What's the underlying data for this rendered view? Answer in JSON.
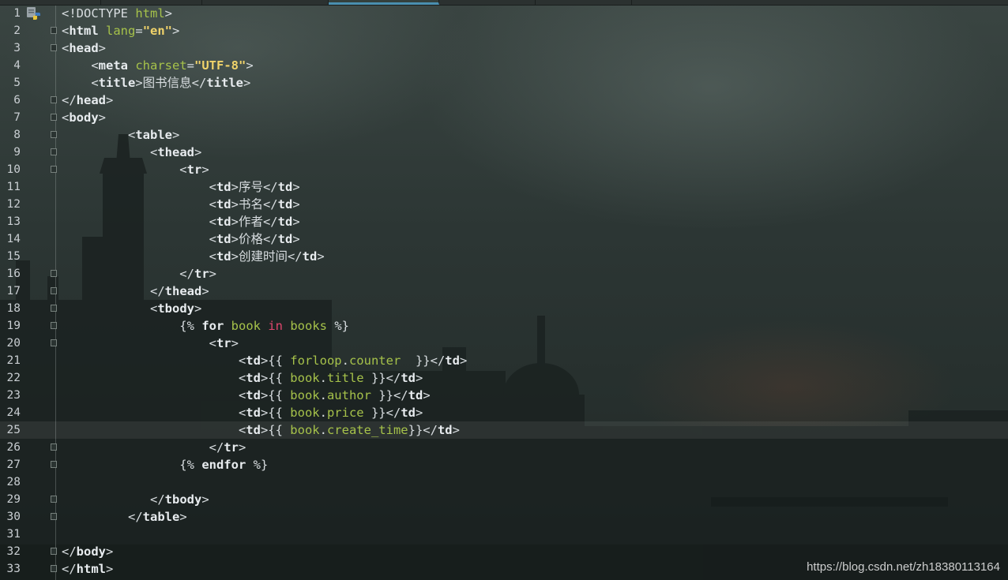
{
  "watermark": "https://blog.csdn.net/zh18380113164",
  "lines": [
    {
      "n": "1",
      "segs": [
        [
          "p",
          "<!DOCTYPE "
        ],
        [
          "attr",
          "html"
        ],
        [
          "p",
          ">"
        ]
      ]
    },
    {
      "n": "2",
      "segs": [
        [
          "p",
          "<"
        ],
        [
          "tag",
          "html"
        ],
        [
          "p",
          " "
        ],
        [
          "attr",
          "lang"
        ],
        [
          "p",
          "="
        ],
        [
          "str",
          "\"en\""
        ],
        [
          "p",
          ">"
        ]
      ]
    },
    {
      "n": "3",
      "segs": [
        [
          "p",
          "<"
        ],
        [
          "tag",
          "head"
        ],
        [
          "p",
          ">"
        ]
      ]
    },
    {
      "n": "4",
      "segs": [
        [
          "p",
          "    <"
        ],
        [
          "tag",
          "meta"
        ],
        [
          "p",
          " "
        ],
        [
          "attr",
          "charset"
        ],
        [
          "p",
          "="
        ],
        [
          "str",
          "\"UTF-8\""
        ],
        [
          "p",
          ">"
        ]
      ]
    },
    {
      "n": "5",
      "segs": [
        [
          "p",
          "    <"
        ],
        [
          "tag",
          "title"
        ],
        [
          "p",
          ">图书信息</"
        ],
        [
          "tag",
          "title"
        ],
        [
          "p",
          ">"
        ]
      ]
    },
    {
      "n": "6",
      "segs": [
        [
          "p",
          "</"
        ],
        [
          "tag",
          "head"
        ],
        [
          "p",
          ">"
        ]
      ]
    },
    {
      "n": "7",
      "segs": [
        [
          "p",
          "<"
        ],
        [
          "tag",
          "body"
        ],
        [
          "p",
          ">"
        ]
      ]
    },
    {
      "n": "8",
      "segs": [
        [
          "p",
          "         <"
        ],
        [
          "tag",
          "table"
        ],
        [
          "p",
          ">"
        ]
      ]
    },
    {
      "n": "9",
      "segs": [
        [
          "p",
          "            <"
        ],
        [
          "tag",
          "thead"
        ],
        [
          "p",
          ">"
        ]
      ]
    },
    {
      "n": "10",
      "segs": [
        [
          "p",
          "                <"
        ],
        [
          "tag",
          "tr"
        ],
        [
          "p",
          ">"
        ]
      ]
    },
    {
      "n": "11",
      "segs": [
        [
          "p",
          "                    <"
        ],
        [
          "tag",
          "td"
        ],
        [
          "p",
          ">序号</"
        ],
        [
          "tag",
          "td"
        ],
        [
          "p",
          ">"
        ]
      ]
    },
    {
      "n": "12",
      "segs": [
        [
          "p",
          "                    <"
        ],
        [
          "tag",
          "td"
        ],
        [
          "p",
          ">书名</"
        ],
        [
          "tag",
          "td"
        ],
        [
          "p",
          ">"
        ]
      ]
    },
    {
      "n": "13",
      "segs": [
        [
          "p",
          "                    <"
        ],
        [
          "tag",
          "td"
        ],
        [
          "p",
          ">作者</"
        ],
        [
          "tag",
          "td"
        ],
        [
          "p",
          ">"
        ]
      ]
    },
    {
      "n": "14",
      "segs": [
        [
          "p",
          "                    <"
        ],
        [
          "tag",
          "td"
        ],
        [
          "p",
          ">价格</"
        ],
        [
          "tag",
          "td"
        ],
        [
          "p",
          ">"
        ]
      ]
    },
    {
      "n": "15",
      "segs": [
        [
          "p",
          "                    <"
        ],
        [
          "tag",
          "td"
        ],
        [
          "p",
          ">创建时间</"
        ],
        [
          "tag",
          "td"
        ],
        [
          "p",
          ">"
        ]
      ]
    },
    {
      "n": "16",
      "segs": [
        [
          "p",
          "                </"
        ],
        [
          "tag",
          "tr"
        ],
        [
          "p",
          ">"
        ]
      ]
    },
    {
      "n": "17",
      "segs": [
        [
          "p",
          "            </"
        ],
        [
          "tag",
          "thead"
        ],
        [
          "p",
          ">"
        ]
      ]
    },
    {
      "n": "18",
      "segs": [
        [
          "p",
          "            <"
        ],
        [
          "tag",
          "tbody"
        ],
        [
          "p",
          ">"
        ]
      ]
    },
    {
      "n": "19",
      "segs": [
        [
          "p",
          "                {% "
        ],
        [
          "kw",
          "for"
        ],
        [
          "p",
          " "
        ],
        [
          "var",
          "book"
        ],
        [
          "p",
          " "
        ],
        [
          "kwin",
          "in"
        ],
        [
          "p",
          " "
        ],
        [
          "var",
          "books"
        ],
        [
          "p",
          " %}"
        ]
      ]
    },
    {
      "n": "20",
      "segs": [
        [
          "p",
          "                    <"
        ],
        [
          "tag",
          "tr"
        ],
        [
          "p",
          ">"
        ]
      ]
    },
    {
      "n": "21",
      "segs": [
        [
          "p",
          "                        <"
        ],
        [
          "tag",
          "td"
        ],
        [
          "p",
          ">{{ "
        ],
        [
          "var",
          "forloop"
        ],
        [
          "p",
          "."
        ],
        [
          "var",
          "counter"
        ],
        [
          "p",
          "  }}</"
        ],
        [
          "tag",
          "td"
        ],
        [
          "p",
          ">"
        ]
      ]
    },
    {
      "n": "22",
      "segs": [
        [
          "p",
          "                        <"
        ],
        [
          "tag",
          "td"
        ],
        [
          "p",
          ">{{ "
        ],
        [
          "var",
          "book"
        ],
        [
          "p",
          "."
        ],
        [
          "var",
          "title"
        ],
        [
          "p",
          " }}</"
        ],
        [
          "tag",
          "td"
        ],
        [
          "p",
          ">"
        ]
      ]
    },
    {
      "n": "23",
      "segs": [
        [
          "p",
          "                        <"
        ],
        [
          "tag",
          "td"
        ],
        [
          "p",
          ">{{ "
        ],
        [
          "var",
          "book"
        ],
        [
          "p",
          "."
        ],
        [
          "var",
          "author"
        ],
        [
          "p",
          " }}</"
        ],
        [
          "tag",
          "td"
        ],
        [
          "p",
          ">"
        ]
      ]
    },
    {
      "n": "24",
      "segs": [
        [
          "p",
          "                        <"
        ],
        [
          "tag",
          "td"
        ],
        [
          "p",
          ">{{ "
        ],
        [
          "var",
          "book"
        ],
        [
          "p",
          "."
        ],
        [
          "var",
          "price"
        ],
        [
          "p",
          " }}</"
        ],
        [
          "tag",
          "td"
        ],
        [
          "p",
          ">"
        ]
      ]
    },
    {
      "n": "25",
      "segs": [
        [
          "p",
          "                        <"
        ],
        [
          "tag",
          "td"
        ],
        [
          "p",
          ">{{ "
        ],
        [
          "var",
          "book"
        ],
        [
          "p",
          "."
        ],
        [
          "var",
          "create_time"
        ],
        [
          "p",
          "}}</"
        ],
        [
          "tag",
          "td"
        ],
        [
          "p",
          ">"
        ]
      ]
    },
    {
      "n": "26",
      "segs": [
        [
          "p",
          "                    </"
        ],
        [
          "tag",
          "tr"
        ],
        [
          "p",
          ">"
        ]
      ]
    },
    {
      "n": "27",
      "segs": [
        [
          "p",
          "                {% "
        ],
        [
          "kw",
          "endfor"
        ],
        [
          "p",
          " %}"
        ]
      ]
    },
    {
      "n": "28",
      "segs": []
    },
    {
      "n": "29",
      "segs": [
        [
          "p",
          "            </"
        ],
        [
          "tag",
          "tbody"
        ],
        [
          "p",
          ">"
        ]
      ]
    },
    {
      "n": "30",
      "segs": [
        [
          "p",
          "         </"
        ],
        [
          "tag",
          "table"
        ],
        [
          "p",
          ">"
        ]
      ]
    },
    {
      "n": "31",
      "segs": []
    },
    {
      "n": "32",
      "segs": [
        [
          "p",
          "</"
        ],
        [
          "tag",
          "body"
        ],
        [
          "p",
          ">"
        ]
      ]
    },
    {
      "n": "33",
      "segs": [
        [
          "p",
          "</"
        ],
        [
          "tag",
          "html"
        ],
        [
          "p",
          ">"
        ]
      ]
    }
  ],
  "current_line": 25,
  "fold_lines": [
    2,
    3,
    6,
    7,
    8,
    9,
    10,
    16,
    17,
    18,
    19,
    20,
    26,
    27,
    29,
    30,
    32,
    33
  ]
}
